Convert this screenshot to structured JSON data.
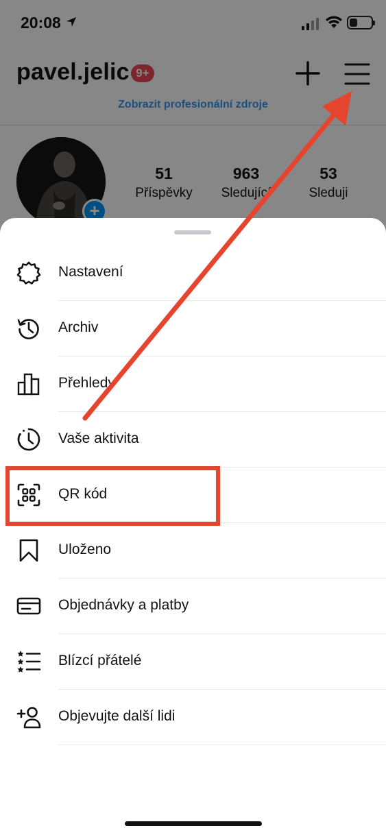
{
  "status_bar": {
    "time": "20:08",
    "battery_level": 0.35
  },
  "profile": {
    "username": "pavel.jelic",
    "notifications_badge": "9+",
    "professional_link": "Zobrazit profesionální zdroje",
    "stats": [
      {
        "value": "51",
        "label": "Příspěvky"
      },
      {
        "value": "963",
        "label": "Sledující"
      },
      {
        "value": "53",
        "label": "Sleduji"
      }
    ]
  },
  "menu": {
    "items": [
      {
        "label": "Nastavení",
        "icon": "settings-icon"
      },
      {
        "label": "Archiv",
        "icon": "archive-icon"
      },
      {
        "label": "Přehledy",
        "icon": "insights-icon"
      },
      {
        "label": "Vaše aktivita",
        "icon": "activity-icon"
      },
      {
        "label": "QR kód",
        "icon": "qr-code-icon"
      },
      {
        "label": "Uloženo",
        "icon": "bookmark-icon"
      },
      {
        "label": "Objednávky a platby",
        "icon": "card-icon"
      },
      {
        "label": "Blízcí přátelé",
        "icon": "close-friends-icon"
      },
      {
        "label": "Objevujte další lidi",
        "icon": "add-person-icon"
      }
    ]
  },
  "colors": {
    "annotation": "#e5442f",
    "link": "#3897f0",
    "badge": "#ed4956"
  }
}
